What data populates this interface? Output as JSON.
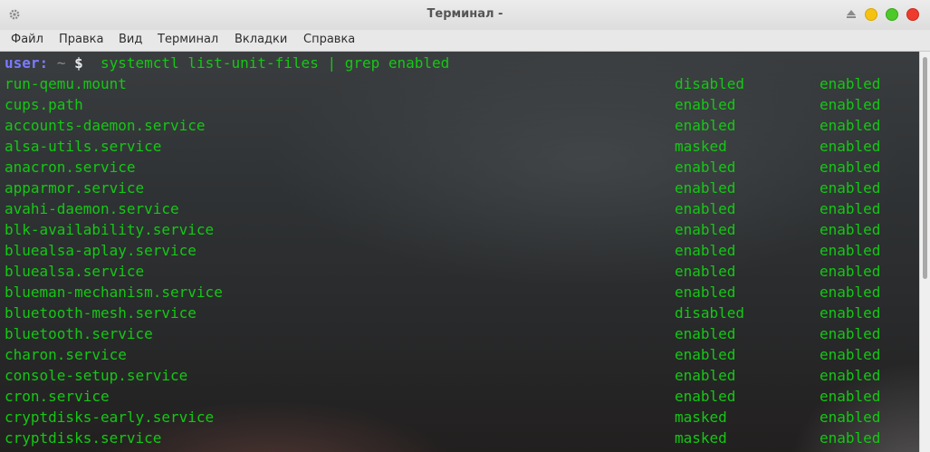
{
  "window": {
    "title": "Терминал -",
    "icons": {
      "settings": "gear-icon",
      "shade": "shade-up-icon"
    },
    "buttons": {
      "minimize_color": "#f5c211",
      "maximize_color": "#4ec92a",
      "close_color": "#ef3b2d"
    }
  },
  "menu": {
    "items": [
      "Файл",
      "Правка",
      "Вид",
      "Терминал",
      "Вкладки",
      "Справка"
    ]
  },
  "terminal": {
    "prompt": {
      "user": "user:",
      "path": "~",
      "symbol": "$",
      "command": "systemctl list-unit-files | grep enabled"
    },
    "colors": {
      "output": "#14c814",
      "user": "#7a7aff"
    },
    "rows": [
      {
        "unit": "run-qemu.mount",
        "state": "disabled",
        "preset": "enabled"
      },
      {
        "unit": "cups.path",
        "state": "enabled",
        "preset": "enabled"
      },
      {
        "unit": "accounts-daemon.service",
        "state": "enabled",
        "preset": "enabled"
      },
      {
        "unit": "alsa-utils.service",
        "state": "masked",
        "preset": "enabled"
      },
      {
        "unit": "anacron.service",
        "state": "enabled",
        "preset": "enabled"
      },
      {
        "unit": "apparmor.service",
        "state": "enabled",
        "preset": "enabled"
      },
      {
        "unit": "avahi-daemon.service",
        "state": "enabled",
        "preset": "enabled"
      },
      {
        "unit": "blk-availability.service",
        "state": "enabled",
        "preset": "enabled"
      },
      {
        "unit": "bluealsa-aplay.service",
        "state": "enabled",
        "preset": "enabled"
      },
      {
        "unit": "bluealsa.service",
        "state": "enabled",
        "preset": "enabled"
      },
      {
        "unit": "blueman-mechanism.service",
        "state": "enabled",
        "preset": "enabled"
      },
      {
        "unit": "bluetooth-mesh.service",
        "state": "disabled",
        "preset": "enabled"
      },
      {
        "unit": "bluetooth.service",
        "state": "enabled",
        "preset": "enabled"
      },
      {
        "unit": "charon.service",
        "state": "enabled",
        "preset": "enabled"
      },
      {
        "unit": "console-setup.service",
        "state": "enabled",
        "preset": "enabled"
      },
      {
        "unit": "cron.service",
        "state": "enabled",
        "preset": "enabled"
      },
      {
        "unit": "cryptdisks-early.service",
        "state": "masked",
        "preset": "enabled"
      },
      {
        "unit": "cryptdisks.service",
        "state": "masked",
        "preset": "enabled"
      }
    ]
  }
}
